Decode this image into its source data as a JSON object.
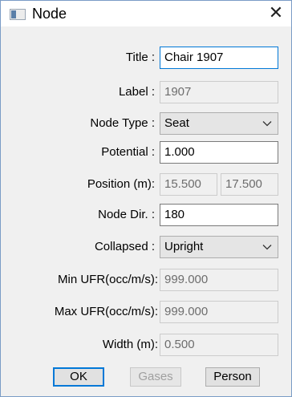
{
  "window": {
    "title": "Node",
    "close_glyph": "✕",
    "icon": "app-window-icon"
  },
  "form": {
    "title_label": "Title :",
    "title_value": "Chair 1907",
    "label_label": "Label :",
    "label_value": "1907",
    "node_type_label": "Node Type :",
    "node_type_value": "Seat",
    "potential_label": "Potential :",
    "potential_value": "1.000",
    "position_label": "Position (m):",
    "position_x": "15.500",
    "position_y": "17.500",
    "node_dir_label": "Node Dir. :",
    "node_dir_value": "180",
    "collapsed_label": "Collapsed :",
    "collapsed_value": "Upright",
    "min_ufr_label": "Min UFR(occ/m/s):",
    "min_ufr_value": "999.000",
    "max_ufr_label": "Max UFR(occ/m/s):",
    "max_ufr_value": "999.000",
    "width_label": "Width (m):",
    "width_value": "0.500"
  },
  "buttons": {
    "ok": "OK",
    "gases": "Gases",
    "person": "Person"
  }
}
